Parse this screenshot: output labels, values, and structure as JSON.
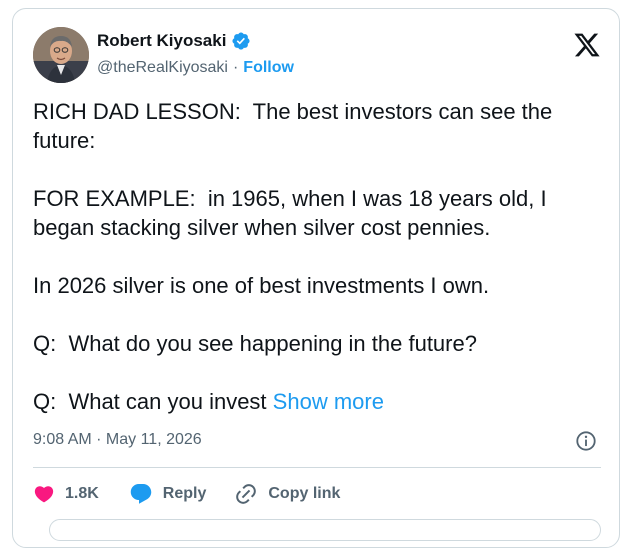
{
  "tweet": {
    "author": {
      "name": "Robert Kiyosaki",
      "handle": "@theRealKiyosaki",
      "separator": "·",
      "follow_label": "Follow"
    },
    "paragraphs": [
      "RICH DAD LESSON:  The best investors can see the future:",
      "FOR EXAMPLE:  in 1965, when I was 18 years old, I began stacking silver when silver cost pennies.",
      "In 2026 silver is one of best investments I own.",
      "Q:  What do you see happening in the future?"
    ],
    "last_paragraph": "Q:  What can you invest ",
    "show_more_label": "Show more",
    "timestamp": "9:08 AM · May 11, 2026",
    "actions": {
      "like_count": "1.8K",
      "reply_label": "Reply",
      "copy_link_label": "Copy link"
    },
    "colors": {
      "accent": "#1d9bf0",
      "like": "#f91880",
      "secondary_text": "#536471",
      "border": "#cfd9de"
    },
    "icons": [
      "x-logo-icon",
      "verified-badge-icon",
      "info-icon",
      "heart-icon",
      "reply-icon",
      "link-icon"
    ]
  }
}
